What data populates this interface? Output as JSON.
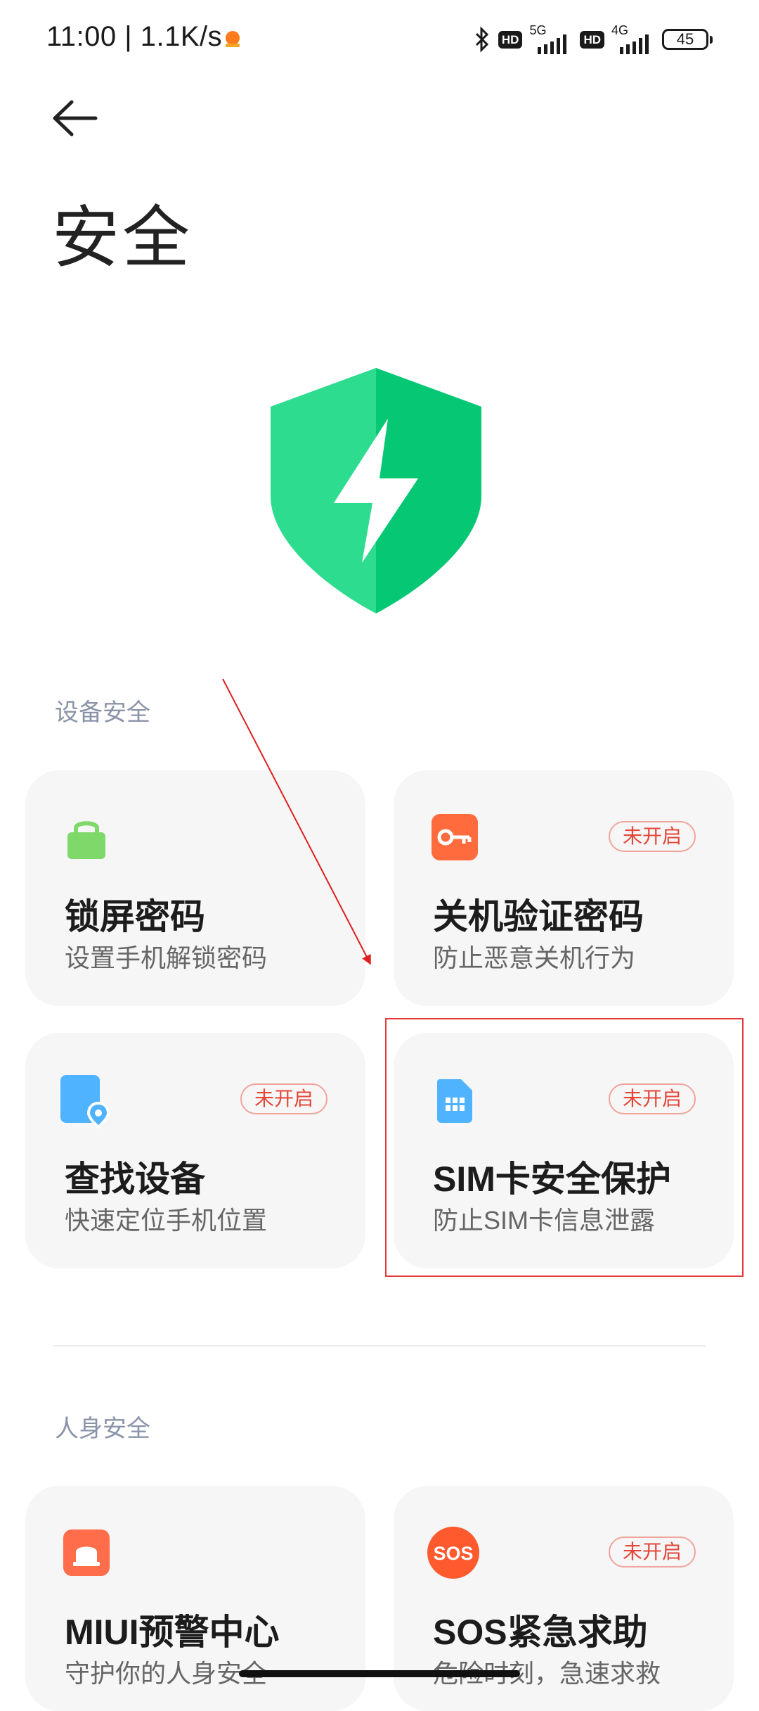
{
  "status_bar": {
    "time": "11:00 | 1.1K/s",
    "hd1": "HD",
    "net1": "5G",
    "hd2": "HD",
    "net2": "4G",
    "battery": "45"
  },
  "page": {
    "title": "安全"
  },
  "sections": {
    "device": {
      "label": "设备安全"
    },
    "personal": {
      "label": "人身安全"
    }
  },
  "cards": {
    "lock_screen": {
      "title": "锁屏密码",
      "subtitle": "设置手机解锁密码",
      "icon": "lock-icon"
    },
    "shutdown_pwd": {
      "title": "关机验证密码",
      "subtitle": "防止恶意关机行为",
      "badge": "未开启",
      "icon": "key-icon"
    },
    "find_device": {
      "title": "查找设备",
      "subtitle": "快速定位手机位置",
      "badge": "未开启",
      "icon": "location-icon"
    },
    "sim_protect": {
      "title": "SIM卡安全保护",
      "subtitle": "防止SIM卡信息泄露",
      "badge": "未开启",
      "icon": "sim-card-icon"
    },
    "miui_alert": {
      "title": "MIUI预警中心",
      "subtitle": "守护你的人身安全",
      "icon": "alarm-icon"
    },
    "sos": {
      "title": "SOS紧急求助",
      "subtitle": "危险时刻，急速求救",
      "badge": "未开启",
      "icon_text": "SOS"
    }
  },
  "colors": {
    "shield_light": "#2edc8f",
    "shield_dark": "#06c774",
    "accent_red": "#e3473a",
    "card_bg": "#f6f6f6"
  }
}
